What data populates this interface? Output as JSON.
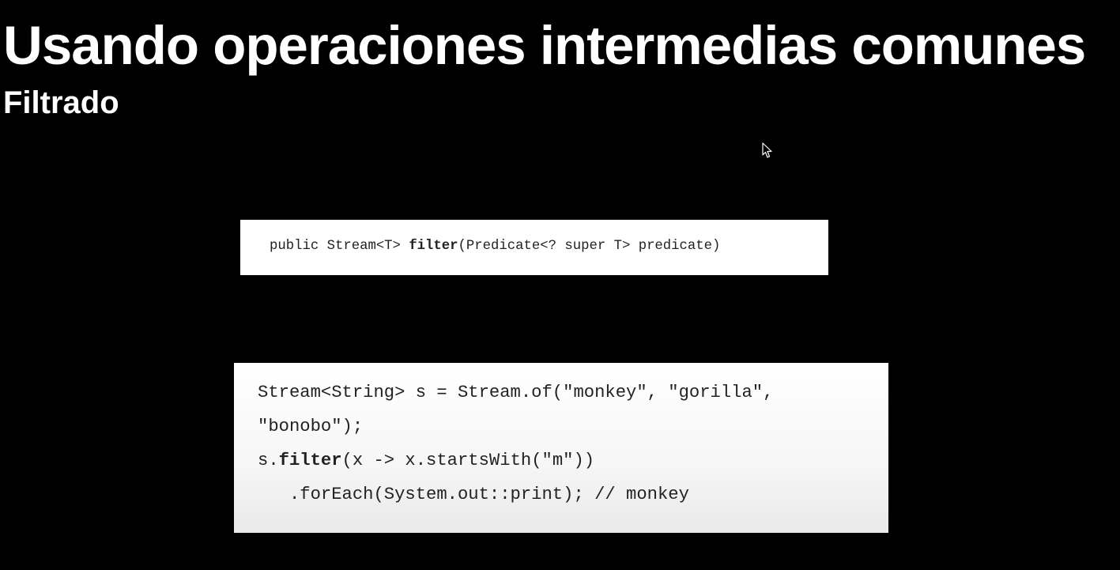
{
  "slide": {
    "title": "Usando operaciones intermedias comunes",
    "subtitle": "Filtrado"
  },
  "signature": {
    "prefix": "public Stream<T> ",
    "method": "filter",
    "suffix": "(Predicate<? super T> predicate)"
  },
  "example": {
    "line1": "Stream<String> s = Stream.of(\"monkey\", \"gorilla\",",
    "line2": "\"bonobo\");",
    "line3_prefix": "s.",
    "line3_method": "filter",
    "line3_suffix": "(x -> x.startsWith(\"m\"))",
    "line4": "   .forEach(System.out::print); // monkey"
  },
  "colors": {
    "background": "#000000",
    "title_text": "#ffffff",
    "code_box": "#ffffff",
    "code_text": "#222222"
  },
  "icons": {
    "cursor": "mouse-pointer-icon"
  }
}
